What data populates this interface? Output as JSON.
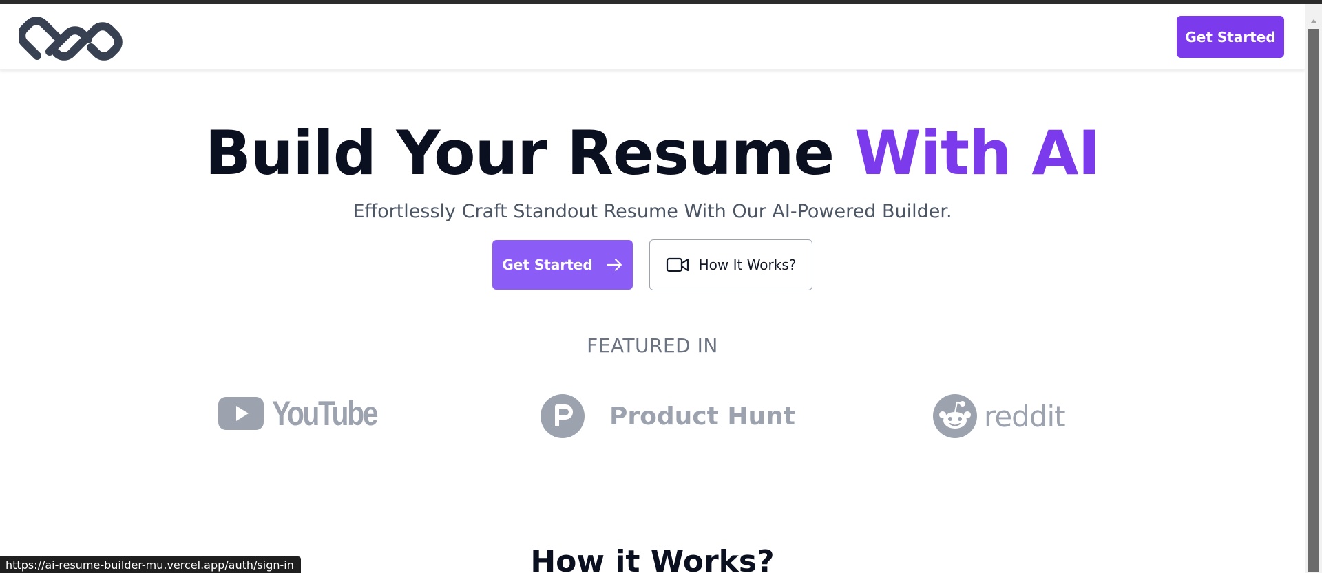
{
  "colors": {
    "brand_purple": "#7c3aed",
    "button_purple": "#8b5cf6",
    "muted_gray": "#9ca3af"
  },
  "header": {
    "logo_icon": "chain-link-logo-icon",
    "cta_label": "Get Started"
  },
  "hero": {
    "title_main": "Build Your Resume ",
    "title_accent": "With AI",
    "subtitle": "Effortlessly Craft Standout Resume With Our AI-Powered Builder.",
    "primary_button": "Get Started",
    "primary_icon": "arrow-right-icon",
    "secondary_button": "How It Works?",
    "secondary_icon": "video-camera-icon"
  },
  "featured": {
    "heading": "FEATURED IN",
    "brands": [
      {
        "name": "YouTube",
        "label": "YouTube",
        "icon": "youtube-play-icon"
      },
      {
        "name": "Product Hunt",
        "label": "Product Hunt",
        "icon": "product-hunt-icon"
      },
      {
        "name": "reddit",
        "label": "reddit",
        "icon": "reddit-alien-icon"
      }
    ]
  },
  "how_it_works": {
    "heading": "How it Works?"
  },
  "browser": {
    "status_url": "https://ai-resume-builder-mu.vercel.app/auth/sign-in"
  }
}
